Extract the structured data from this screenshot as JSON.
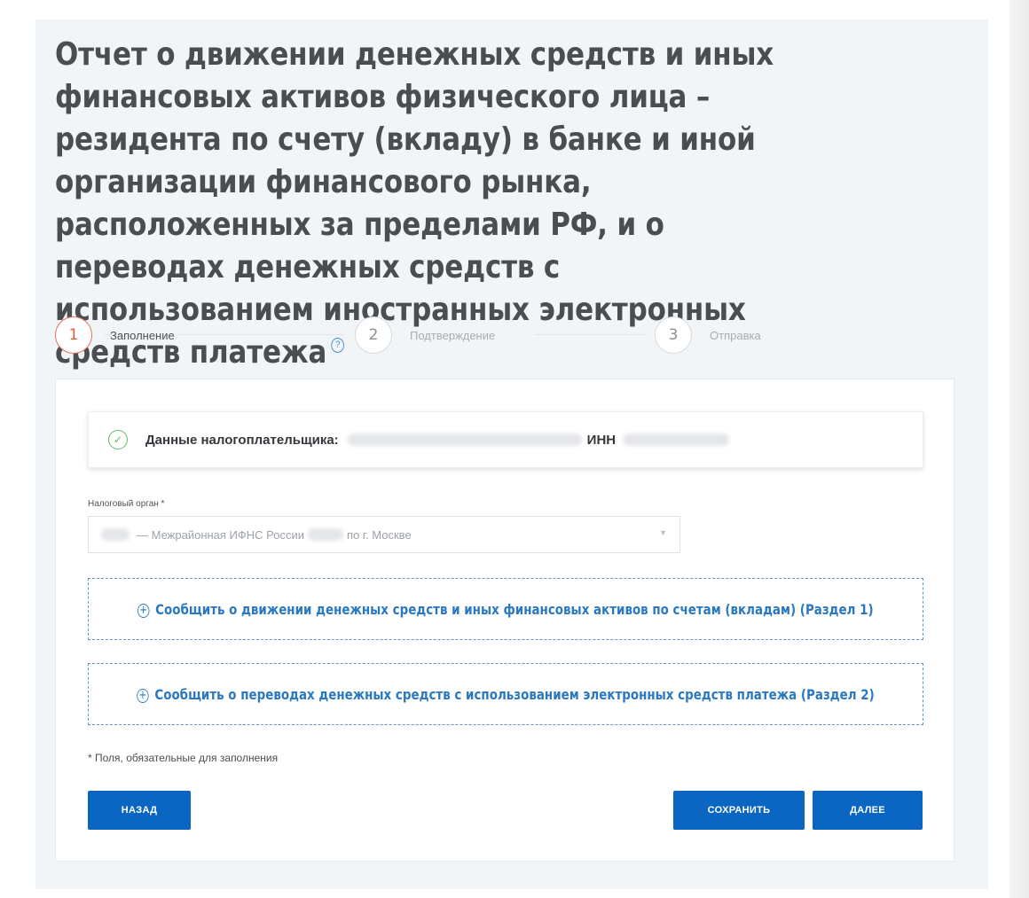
{
  "page": {
    "title": "Отчет о движении денежных средств и иных финансовых активов физического лица – резидента по счету (вкладу) в банке и иной организации финансового рынка, расположенных за пределами РФ, и о переводах денежных средств с использованием иностранных электронных средств платежа",
    "help_icon": "?"
  },
  "steps": [
    {
      "number": "1",
      "label": "Заполнение",
      "active": true
    },
    {
      "number": "2",
      "label": "Подтверждение",
      "active": false
    },
    {
      "number": "3",
      "label": "Отправка",
      "active": false
    }
  ],
  "taxpayer": {
    "label": "Данные налогоплательщика:",
    "inn_label": "ИНН",
    "check_icon": "✓"
  },
  "tax_office": {
    "label": "Налоговый орган *",
    "value_part1": "— Межрайонная ИФНС России",
    "value_part2": "по г. Москве",
    "arrow": "▼"
  },
  "actions": {
    "section1": "Сообщить о движении денежных средств и иных финансовых активов по счетам (вкладам) (Раздел 1)",
    "section2": "Сообщить о переводах денежных средств с использованием электронных средств платежа (Раздел 2)",
    "plus_icon": "+"
  },
  "required_note": "* Поля, обязательные для заполнения",
  "buttons": {
    "back": "НАЗАД",
    "save": "СОХРАНИТЬ",
    "next": "ДАЛЕЕ"
  },
  "colors": {
    "primary": "#0b66c3",
    "link": "#2b78c2",
    "active_step": "#e0603e",
    "success": "#5fbf63",
    "panel_bg": "#f1f5f8"
  }
}
